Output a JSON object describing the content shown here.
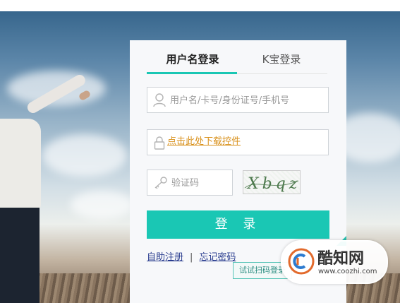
{
  "tabs": {
    "username_login": "用户名登录",
    "kbao_login": "K宝登录"
  },
  "form": {
    "username_placeholder": "用户名/卡号/身份证号/手机号",
    "plugin_link": "点击此处下载控件",
    "captcha_placeholder": "验证码",
    "captcha_text": "Xbqz",
    "login_button": "登 录"
  },
  "links": {
    "self_register": "自助注册",
    "separator": "|",
    "forgot_password": "忘记密码"
  },
  "qr_tooltip": "试试扫码登录",
  "watermark": {
    "name": "酷知网",
    "url": "www.coozhi.com"
  },
  "colors": {
    "accent": "#1ac7b4",
    "link": "#2a3d8f",
    "plugin_link": "#d9911c"
  }
}
